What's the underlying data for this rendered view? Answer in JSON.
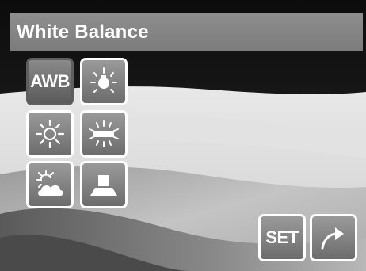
{
  "title": "White Balance",
  "options": [
    {
      "label": "AWB",
      "icon": "awb-text",
      "selected": true
    },
    {
      "label": "",
      "icon": "incandescent-icon",
      "selected": false
    },
    {
      "label": "",
      "icon": "daylight-icon",
      "selected": false
    },
    {
      "label": "",
      "icon": "fluorescent-icon",
      "selected": false
    },
    {
      "label": "",
      "icon": "cloudy-icon",
      "selected": false
    },
    {
      "label": "",
      "icon": "custom-wb-icon",
      "selected": false
    }
  ],
  "controls": {
    "set_label": "SET",
    "exit_icon": "return-arrow-icon"
  },
  "colors": {
    "button_fill": "#7f7f7f",
    "button_border": "#ffffff",
    "selected_border": "#5e5e5e",
    "title_bar": "#858585",
    "text": "#ffffff"
  }
}
